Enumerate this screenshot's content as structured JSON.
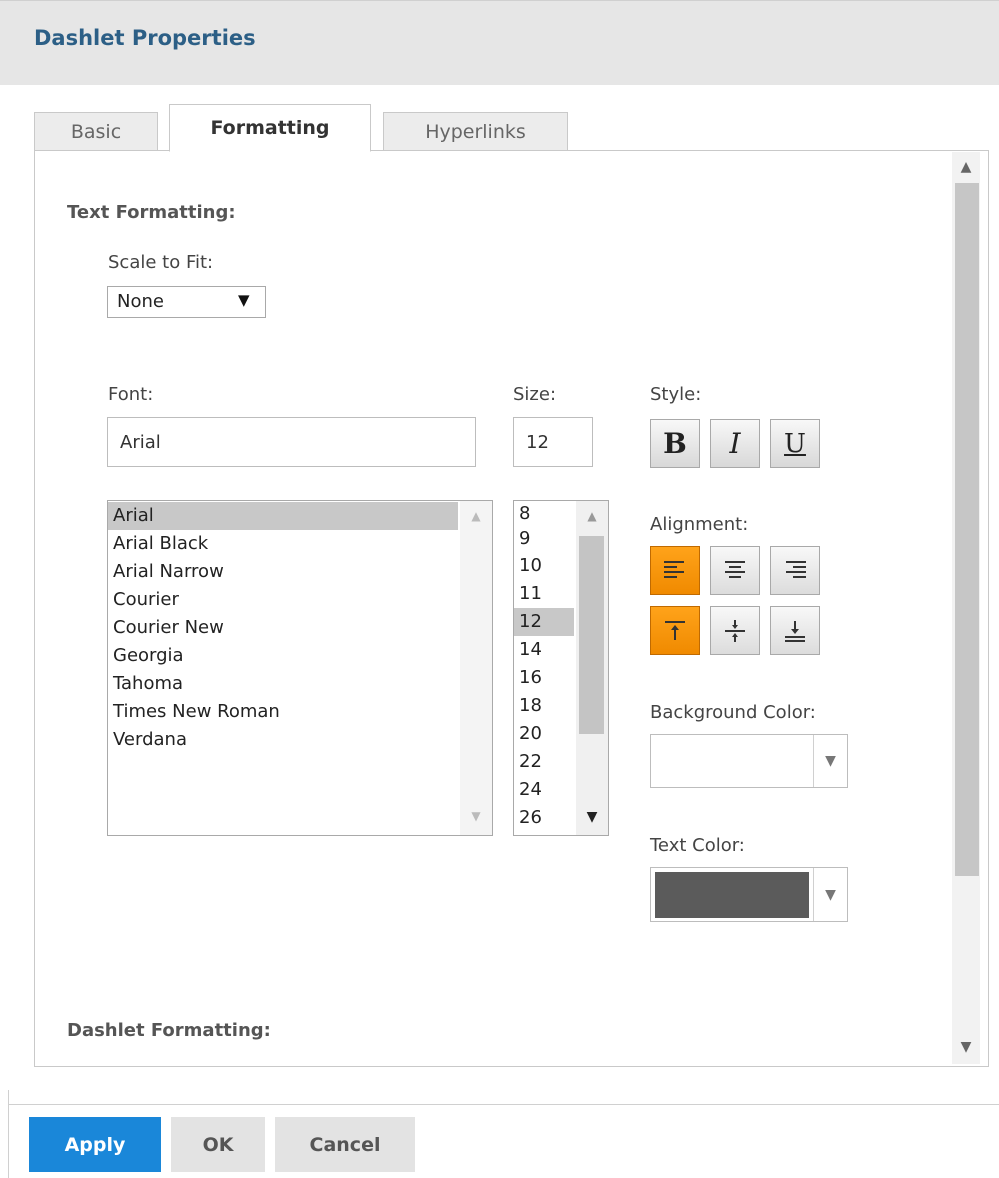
{
  "dialog": {
    "title": "Dashlet Properties"
  },
  "tabs": [
    {
      "label": "Basic"
    },
    {
      "label": "Formatting"
    },
    {
      "label": "Hyperlinks"
    }
  ],
  "text_formatting": {
    "heading": "Text Formatting:",
    "scale_to_fit": {
      "label": "Scale to Fit:",
      "value": "None"
    },
    "font": {
      "label": "Font:",
      "value": "Arial",
      "options": [
        "Arial",
        "Arial Black",
        "Arial Narrow",
        "Courier",
        "Courier New",
        "Georgia",
        "Tahoma",
        "Times New Roman",
        "Verdana"
      ],
      "selected": "Arial"
    },
    "size": {
      "label": "Size:",
      "value": "12",
      "options": [
        "8",
        "9",
        "10",
        "11",
        "12",
        "14",
        "16",
        "18",
        "20",
        "22",
        "24",
        "26"
      ],
      "selected": "12"
    },
    "style": {
      "label": "Style:",
      "bold": "B",
      "italic": "I",
      "underline": "U"
    },
    "alignment": {
      "label": "Alignment:",
      "horizontal_selected": "left",
      "vertical_selected": "top"
    },
    "background_color": {
      "label": "Background Color:",
      "value": "#ffffff"
    },
    "text_color": {
      "label": "Text Color:",
      "value": "#5b5b5b"
    }
  },
  "dashlet_formatting": {
    "heading": "Dashlet Formatting:"
  },
  "footer": {
    "apply": "Apply",
    "ok": "OK",
    "cancel": "Cancel"
  },
  "colors": {
    "accent": "#1a87d9",
    "title": "#2c5f86",
    "active_align": "#f59300"
  }
}
